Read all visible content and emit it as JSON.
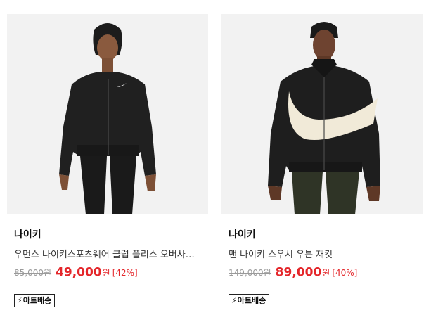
{
  "products": [
    {
      "brand": "나이키",
      "name": "우먼스 나이키스포츠웨어 클럽 플리스 오버사이즈 크롭 풀집 재킷",
      "original_price": "85,000원",
      "sale_price": "49,000",
      "currency": "원",
      "discount": "[42%]",
      "badge": "아트배송",
      "image_icon": "womens-black-cropped-jacket-photo"
    },
    {
      "brand": "나이키",
      "name": "맨 나이키 스우시 우븐 재킷",
      "original_price": "149,000원",
      "sale_price": "89,000",
      "currency": "원",
      "discount": "[40%]",
      "badge": "아트배송",
      "image_icon": "mens-swoosh-woven-jacket-photo"
    }
  ],
  "colors": {
    "sale_red": "#e4262a",
    "muted_gray": "#9a9a9a",
    "thumb_bg": "#f2f2f2"
  }
}
